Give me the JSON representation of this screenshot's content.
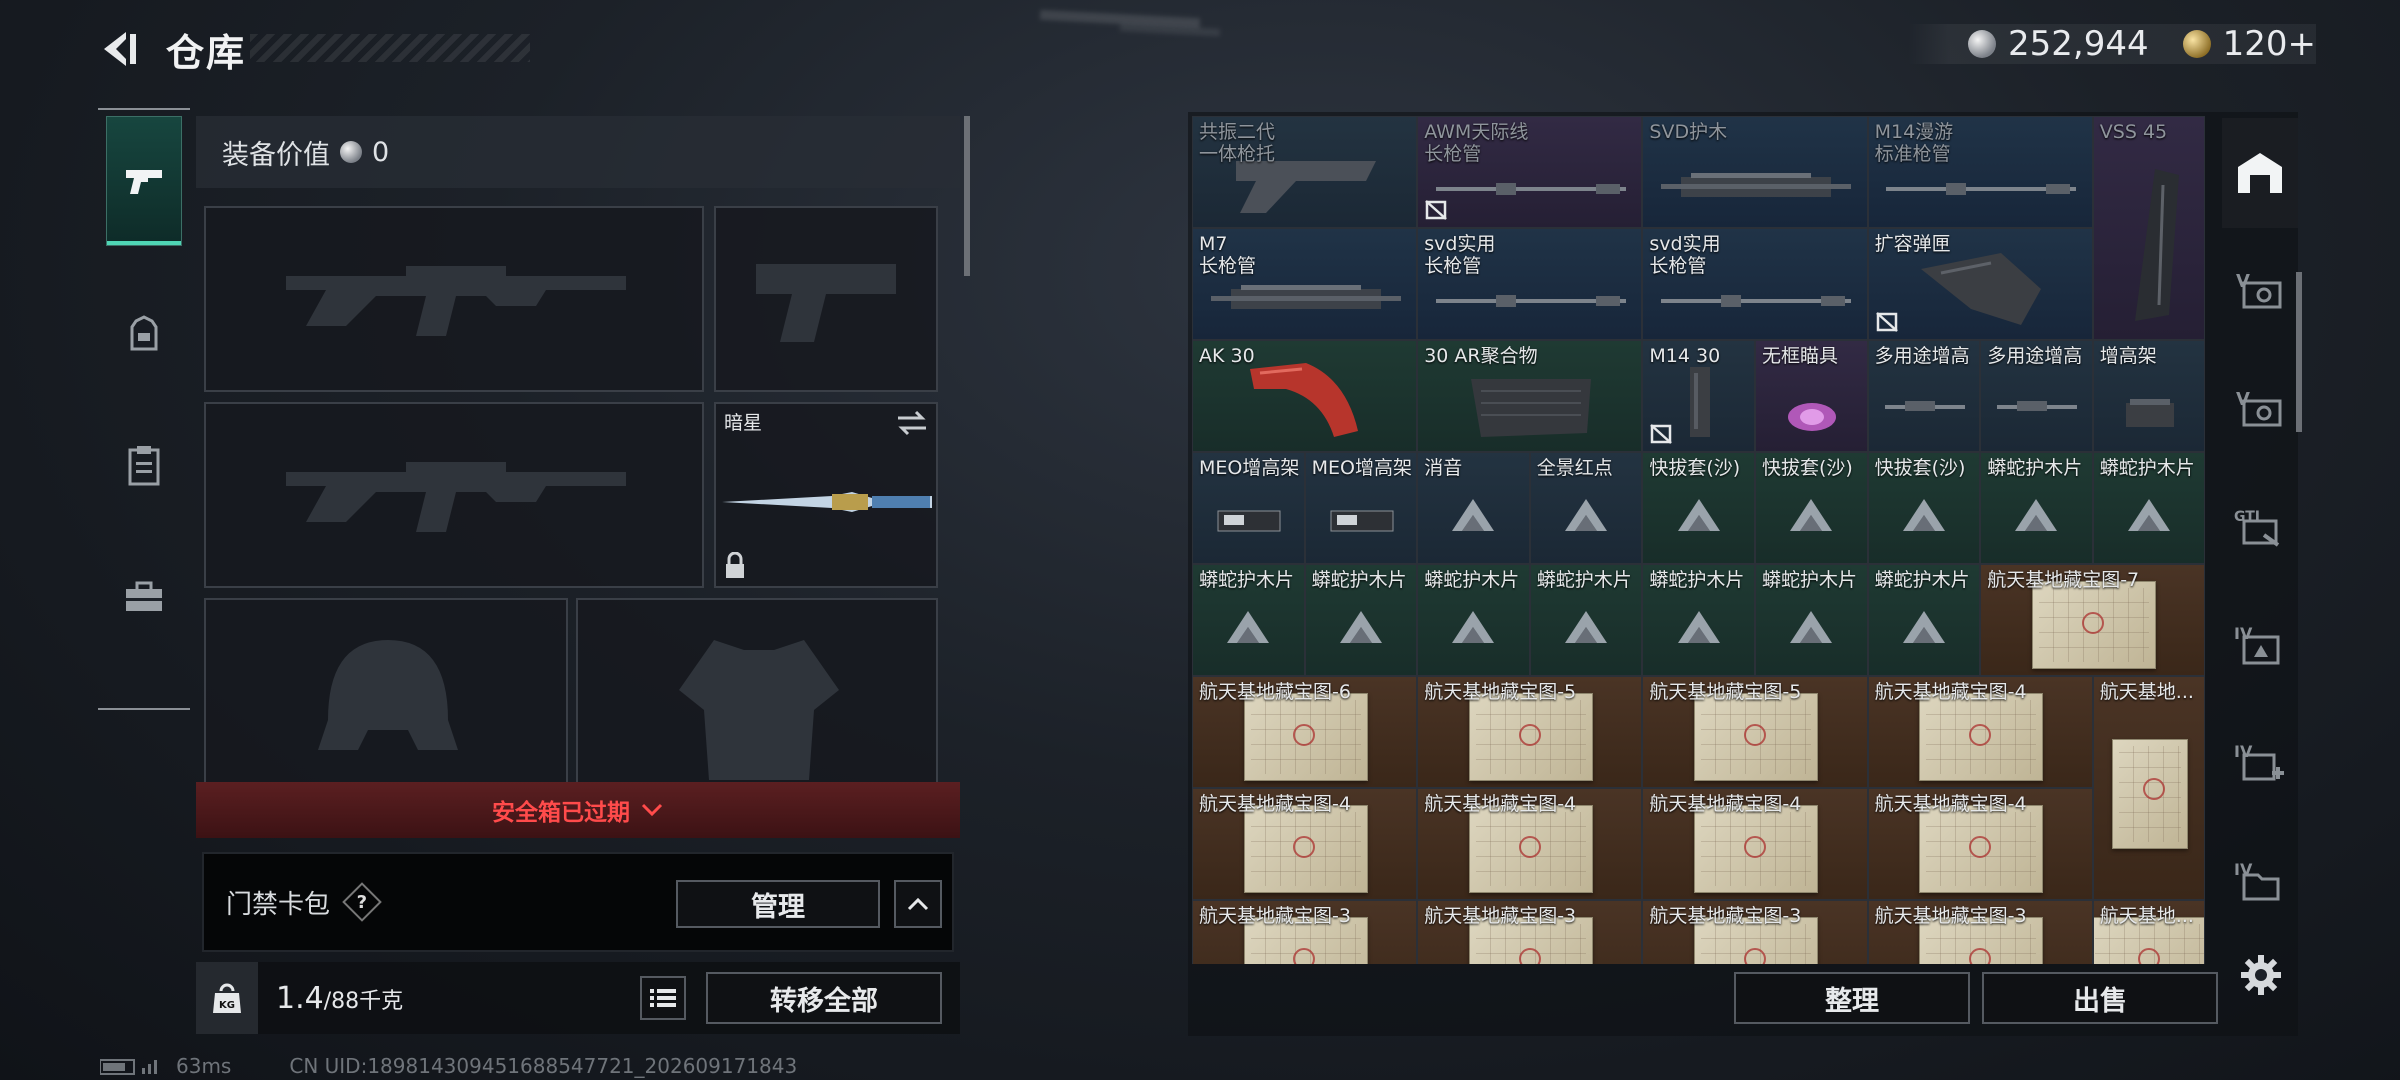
{
  "header": {
    "title": "仓库",
    "currency_silver": "252,944",
    "currency_gold": "120+"
  },
  "equipment": {
    "value_label": "装备价值",
    "value": "0",
    "knife_name": "暗星",
    "safebox_text": "安全箱已过期"
  },
  "keycard": {
    "label": "门禁卡包",
    "help": "?",
    "manage_label": "管理"
  },
  "weight": {
    "icon_text": "KG",
    "current": "1.4",
    "max": "/88千克",
    "transfer_label": "转移全部"
  },
  "status": {
    "ping": "63ms",
    "uid": "CN UID:189814309451688547721_202609171843"
  },
  "actions": {
    "tidy_label": "整理",
    "sell_label": "出售"
  },
  "grid": {
    "row1": [
      "共振二代\n一体枪托",
      "AWM天际线\n长枪管",
      "SVD护木",
      "M14漫游\n标准枪管",
      "VSS 45"
    ],
    "row2": [
      "M7\n长枪管",
      "svd实用\n长枪管",
      "svd实用\n长枪管",
      "扩容弹匣"
    ],
    "row3": [
      "AK 30",
      "30 AR聚合物",
      "M14 30",
      "无框瞄具",
      "多用途增高",
      "多用途增高",
      "增高架"
    ],
    "row4": [
      "MEO增高架",
      "MEO增高架",
      "消音",
      "全景红点",
      "快拔套(沙)",
      "快拔套(沙)",
      "快拔套(沙)",
      "蟒蛇护木片",
      "蟒蛇护木片"
    ],
    "row5": [
      "蟒蛇护木片",
      "蟒蛇护木片",
      "蟒蛇护木片",
      "蟒蛇护木片",
      "蟒蛇护木片",
      "蟒蛇护木片",
      "蟒蛇护木片",
      "航天基地藏宝图-7"
    ],
    "row6": [
      "航天基地藏宝图-6",
      "航天基地藏宝图-5",
      "航天基地藏宝图-5",
      "航天基地藏宝图-4",
      "航天基地..."
    ],
    "row7": [
      "航天基地藏宝图-4",
      "航天基地藏宝图-4",
      "航天基地藏宝图-4",
      "航天基地藏宝图-4"
    ],
    "row8": [
      "航天基地藏宝图-3",
      "航天基地藏宝图-3",
      "航天基地藏宝图-3",
      "航天基地藏宝图-3",
      "航天基地..."
    ]
  }
}
